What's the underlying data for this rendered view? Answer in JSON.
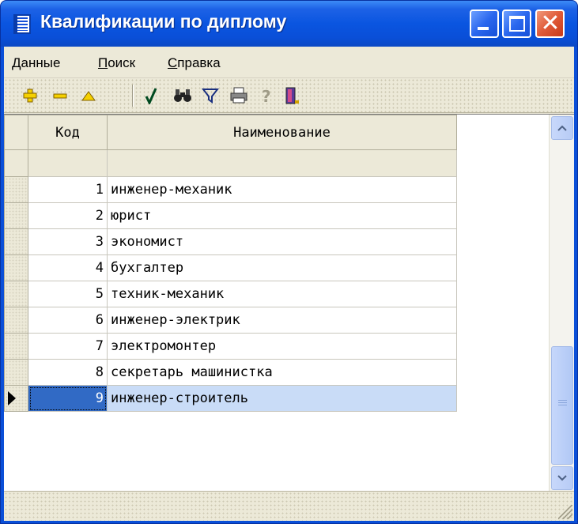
{
  "window": {
    "title": "Квалификации по диплому"
  },
  "menu": {
    "items": [
      {
        "label": "Данные",
        "accel": "Д",
        "rest": "анные"
      },
      {
        "label": "Поиск",
        "accel": "П",
        "rest": "оиск"
      },
      {
        "label": "Справка",
        "accel": "С",
        "rest": "правка"
      }
    ]
  },
  "toolbar": {
    "buttons": [
      "add-record-icon",
      "delete-record-icon",
      "edit-record-icon",
      "post-check-icon",
      "find-binoculars-icon",
      "filter-funnel-icon",
      "print-icon",
      "help-icon",
      "exit-door-icon"
    ]
  },
  "grid": {
    "columns": [
      "Код",
      "Наименование"
    ],
    "filter": {
      "kod": "",
      "name": ""
    },
    "rows": [
      {
        "kod": "1",
        "name": "инженер-механик"
      },
      {
        "kod": "2",
        "name": "юрист"
      },
      {
        "kod": "3",
        "name": "экономист"
      },
      {
        "kod": "4",
        "name": "бухгалтер"
      },
      {
        "kod": "5",
        "name": "техник-механик"
      },
      {
        "kod": "6",
        "name": "инженер-электрик"
      },
      {
        "kod": "7",
        "name": "электромонтер"
      },
      {
        "kod": "8",
        "name": "секретарь машинистка"
      },
      {
        "kod": "9",
        "name": "инженер-строитель"
      }
    ],
    "selected_row": 9
  },
  "colors": {
    "titlebar": "#0a4fd8",
    "selection": "#316ac5",
    "selection_light": "#c9dcf7",
    "face": "#ece9d8"
  }
}
